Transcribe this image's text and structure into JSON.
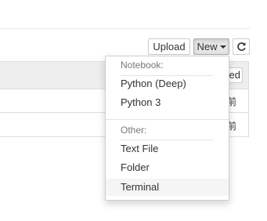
{
  "toolbar": {
    "upload_label": "Upload",
    "new_label": "New",
    "refresh_icon": "refresh-icon"
  },
  "table": {
    "header_button_label": "ed",
    "rows": [
      {
        "time": "前"
      },
      {
        "time": "前"
      }
    ]
  },
  "new_menu": {
    "notebook_header": "Notebook:",
    "notebook_items": [
      "Python (Deep)",
      "Python 3"
    ],
    "other_header": "Other:",
    "other_items": [
      "Text File",
      "Folder",
      "Terminal"
    ],
    "highlighted_item": "Terminal"
  }
}
